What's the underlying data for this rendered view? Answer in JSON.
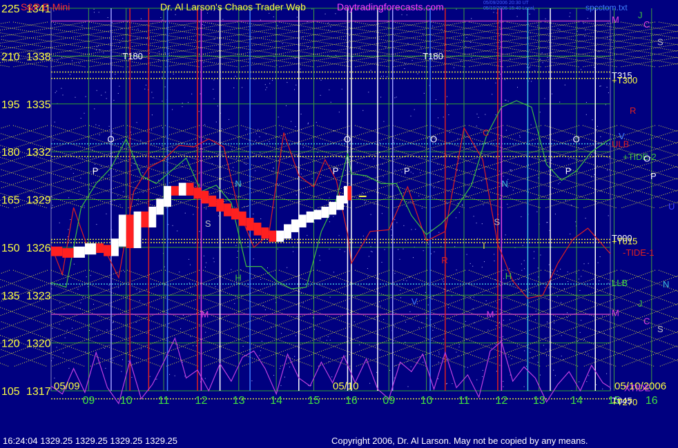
{
  "header": {
    "product": "S&P E-Mini",
    "title": "Dr. Al Larson's Chaos Trader Web",
    "website": "Daytradingforecasts.com",
    "file": "spcctom.txt",
    "stamp_line1": "05/09/2006 20:30 UT",
    "stamp_line2": "05/10/2006 15:40 Local"
  },
  "footer": {
    "status": "16:24:04  1329.25 1329.25 1329.25 1329.25",
    "copyright": "Copyright 2006, Dr. Al Larson. May not be copied by any means."
  },
  "colors": {
    "background": "#000080",
    "price_up": "#ffffff",
    "price_down": "#ff2020",
    "green_line": "#40c040",
    "red_line": "#e02020",
    "magenta_line": "#c040e0",
    "yellow_dotted": "#e0e040",
    "magenta_level": "#c040c0",
    "cyan": "#40c0e0"
  },
  "chart_data": {
    "type": "line",
    "title": "Dr. Al Larson's Chaos Trader Web",
    "y_left_labels": [
      {
        "left": "225",
        "right": "1341"
      },
      {
        "left": "210",
        "right": "1338"
      },
      {
        "left": "195",
        "right": "1335"
      },
      {
        "left": "180",
        "right": "1332"
      },
      {
        "left": "165",
        "right": "1329"
      },
      {
        "left": "150",
        "right": "1326"
      },
      {
        "left": "135",
        "right": "1323"
      },
      {
        "left": "120",
        "right": "1320"
      },
      {
        "left": "105",
        "right": "1317"
      }
    ],
    "ylim": [
      1317,
      1341
    ],
    "x_hours": [
      "09",
      "10",
      "11",
      "12",
      "13",
      "14",
      "15",
      "16",
      "09",
      "10",
      "11",
      "12",
      "13",
      "14",
      "15",
      "16"
    ],
    "date_labels": [
      "05/09",
      "05/10",
      "05/10/2006"
    ],
    "right_labels": [
      {
        "text": "M",
        "color": "#e040e0",
        "price": 1340.3
      },
      {
        "text": "C",
        "color": "#e040e0",
        "price": 1340.0
      },
      {
        "text": "J",
        "color": "#40c040",
        "price": 1340.6
      },
      {
        "text": "S",
        "color": "#c0c0c0",
        "price": 1338.9
      },
      {
        "text": "T315",
        "color": "#ffffff",
        "price": 1336.8
      },
      {
        "text": "+T300",
        "color": "#ffff40",
        "price": 1336.5
      },
      {
        "text": "R",
        "color": "#e02020",
        "price": 1334.6
      },
      {
        "text": "V",
        "color": "#4080ff",
        "price": 1333.0
      },
      {
        "text": "ULB",
        "color": "#e02020",
        "price": 1332.5
      },
      {
        "text": "+TIDE-2",
        "color": "#40c040",
        "price": 1331.7
      },
      {
        "text": "O",
        "color": "#ffffff",
        "price": 1331.6
      },
      {
        "text": "P",
        "color": "#ffffff",
        "price": 1330.5
      },
      {
        "text": "U",
        "color": "#4040ff",
        "price": 1328.6
      },
      {
        "text": "T000",
        "color": "#ffffff",
        "price": 1326.6
      },
      {
        "text": "+T015",
        "color": "#ffff40",
        "price": 1326.4
      },
      {
        "text": "-TIDE-1",
        "color": "#e02020",
        "price": 1325.7
      },
      {
        "text": "LLB",
        "color": "#40e040",
        "price": 1323.8
      },
      {
        "text": "N",
        "color": "#40c0e0",
        "price": 1323.7
      },
      {
        "text": "J",
        "color": "#40c040",
        "price": 1322.5
      },
      {
        "text": "M",
        "color": "#e040e0",
        "price": 1321.9
      },
      {
        "text": "C",
        "color": "#e040e0",
        "price": 1321.4
      },
      {
        "text": "S",
        "color": "#c0c0c0",
        "price": 1320.9
      },
      {
        "text": "XTIDE",
        "color": "#e040e0",
        "price": 1317.2
      },
      {
        "text": "T045",
        "color": "#ffffff",
        "price": 1316.4
      },
      {
        "text": "+T270",
        "color": "#ffff40",
        "price": 1316.3
      }
    ],
    "inner_labels": [
      {
        "text": "T180",
        "color": "#ffffff",
        "hour": 9.9,
        "price": 1337.8
      },
      {
        "text": "T180",
        "color": "#ffffff",
        "hour": 17.9,
        "price": 1337.8
      },
      {
        "text": "O",
        "color": "#ffffff",
        "hour": 9.5,
        "price": 1332.6
      },
      {
        "text": "O",
        "color": "#ffffff",
        "hour": 15.8,
        "price": 1332.6
      },
      {
        "text": "O",
        "color": "#ffffff",
        "hour": 18.1,
        "price": 1332.6
      },
      {
        "text": "O",
        "color": "#ffffff",
        "hour": 21.9,
        "price": 1332.6
      },
      {
        "text": "P",
        "color": "#ffffff",
        "hour": 9.1,
        "price": 1330.6
      },
      {
        "text": "P",
        "color": "#ffffff",
        "hour": 15.5,
        "price": 1330.6
      },
      {
        "text": "P",
        "color": "#ffffff",
        "hour": 17.4,
        "price": 1330.6
      },
      {
        "text": "P",
        "color": "#ffffff",
        "hour": 21.7,
        "price": 1330.6
      },
      {
        "text": "N",
        "color": "#40c0e0",
        "hour": 12.9,
        "price": 1329.8
      },
      {
        "text": "N",
        "color": "#40c0e0",
        "hour": 20.0,
        "price": 1329.8
      },
      {
        "text": "S",
        "color": "#c0c0c0",
        "hour": 12.1,
        "price": 1327.3
      },
      {
        "text": "S",
        "color": "#c0c0c0",
        "hour": 19.8,
        "price": 1327.4
      },
      {
        "text": "H",
        "color": "#40c040",
        "hour": 12.9,
        "price": 1323.9
      },
      {
        "text": "H",
        "color": "#40c040",
        "hour": 20.1,
        "price": 1324.0
      },
      {
        "text": "C",
        "color": "#e02020",
        "hour": 19.5,
        "price": 1333.0
      },
      {
        "text": "R",
        "color": "#e02020",
        "hour": 18.4,
        "price": 1325.0
      },
      {
        "text": "V",
        "color": "#4080ff",
        "hour": 17.6,
        "price": 1322.4
      },
      {
        "text": "M",
        "color": "#e040e0",
        "hour": 12.0,
        "price": 1321.6
      },
      {
        "text": "M",
        "color": "#e040e0",
        "hour": 19.6,
        "price": 1321.6
      },
      {
        "text": "I",
        "color": "#e0e040",
        "hour": 19.5,
        "price": 1325.9
      }
    ],
    "price_series": {
      "name": "S&P E-Mini",
      "x": [
        8.0,
        8.3,
        8.6,
        8.9,
        9.2,
        9.4,
        9.6,
        9.8,
        10.0,
        10.2,
        10.4,
        10.6,
        10.8,
        11.0,
        11.2,
        11.4,
        11.6,
        11.8,
        12.0,
        12.2,
        12.4,
        12.6,
        12.8,
        13.0,
        13.2,
        13.4,
        13.6,
        13.8,
        14.0,
        14.2,
        14.4,
        14.6,
        14.8,
        15.0,
        15.2,
        15.4,
        15.6,
        15.8,
        15.9,
        16.0
      ],
      "y": [
        1325.8,
        1325.7,
        1325.6,
        1325.8,
        1326.0,
        1325.9,
        1325.7,
        1326.3,
        1327.8,
        1326.2,
        1328.0,
        1327.5,
        1328.3,
        1328.8,
        1329.6,
        1329.5,
        1329.8,
        1329.5,
        1329.3,
        1329.0,
        1328.8,
        1328.5,
        1328.2,
        1328.0,
        1327.6,
        1327.3,
        1327.0,
        1326.8,
        1326.6,
        1326.8,
        1327.2,
        1327.5,
        1327.8,
        1328.0,
        1328.1,
        1328.3,
        1328.6,
        1329.0,
        1329.6,
        1329.2
      ]
    },
    "green_series": {
      "x": [
        8.0,
        8.4,
        8.8,
        9.2,
        9.6,
        10.0,
        10.4,
        10.8,
        11.2,
        11.6,
        12.0,
        12.4,
        12.8,
        13.2,
        13.6,
        14.0,
        14.4,
        14.8,
        15.2,
        15.6,
        15.9,
        16.0,
        16.4,
        16.8,
        17.2,
        17.6,
        18.0,
        18.4,
        18.8,
        19.2,
        19.6,
        20.0,
        20.4,
        20.8,
        21.2,
        21.6,
        22.0,
        22.4,
        22.9
      ],
      "y": [
        1323.8,
        1323.5,
        1328.5,
        1330.0,
        1331.0,
        1332.8,
        1330.5,
        1330.0,
        1330.8,
        1331.6,
        1329.5,
        1329.9,
        1328.8,
        1324.8,
        1324.8,
        1323.9,
        1323.4,
        1323.5,
        1327.0,
        1329.0,
        1331.9,
        1330.6,
        1330.5,
        1330.0,
        1330.0,
        1328.0,
        1326.8,
        1327.5,
        1328.5,
        1329.9,
        1333.0,
        1334.8,
        1335.2,
        1334.8,
        1331.2,
        1330.2,
        1330.8,
        1332.0,
        1332.8
      ]
    },
    "red_series": {
      "x": [
        8.0,
        8.3,
        8.6,
        9.0,
        9.4,
        9.8,
        10.2,
        10.6,
        11.0,
        11.4,
        11.8,
        12.2,
        12.6,
        13.0,
        13.4,
        13.8,
        14.2,
        14.6,
        15.0,
        15.3,
        15.6,
        15.9,
        16.0,
        16.5,
        17.0,
        17.5,
        18.0,
        18.5,
        19.0,
        19.5,
        19.9,
        20.3,
        20.7,
        21.1,
        21.5,
        21.9,
        22.3,
        22.9
      ],
      "y": [
        1326.1,
        1324.3,
        1328.5,
        1325.8,
        1326.0,
        1324.1,
        1329.5,
        1331.0,
        1331.5,
        1332.4,
        1332.3,
        1332.8,
        1332.3,
        1328.3,
        1326.0,
        1326.8,
        1333.2,
        1330.5,
        1329.8,
        1331.5,
        1330.2,
        1326.8,
        1325.0,
        1327.0,
        1327.1,
        1329.8,
        1326.4,
        1327.0,
        1333.5,
        1331.5,
        1326.2,
        1323.9,
        1322.8,
        1323.0,
        1325.0,
        1326.5,
        1327.2,
        1325.6
      ]
    },
    "xtide_series": {
      "name": "XTIDE",
      "x": [
        8.0,
        8.3,
        8.6,
        8.9,
        9.2,
        9.5,
        9.8,
        10.1,
        10.4,
        10.7,
        11.0,
        11.3,
        11.6,
        11.9,
        12.2,
        12.5,
        12.8,
        13.1,
        13.4,
        13.7,
        14.0,
        14.3,
        14.6,
        14.9,
        15.2,
        15.5,
        15.8,
        16.1,
        16.4,
        16.7,
        17.0,
        17.3,
        17.6,
        17.9,
        18.2,
        18.5,
        18.8,
        19.1,
        19.4,
        19.7,
        20.0,
        20.3,
        20.6,
        20.9,
        21.2,
        21.5,
        21.8,
        22.1,
        22.4,
        22.7,
        22.9
      ],
      "y": [
        1317.3,
        1316.8,
        1318.4,
        1316.9,
        1319.4,
        1317.2,
        1316.2,
        1318.9,
        1316.5,
        1317.4,
        1318.8,
        1320.3,
        1317.8,
        1318.3,
        1317.0,
        1318.7,
        1317.6,
        1319.1,
        1319.5,
        1318.4,
        1316.8,
        1319.3,
        1317.8,
        1317.3,
        1318.8,
        1317.5,
        1319.2,
        1317.5,
        1319.0,
        1317.1,
        1316.5,
        1318.8,
        1318.2,
        1319.3,
        1317.1,
        1319.4,
        1317.2,
        1318.0,
        1316.6,
        1319.5,
        1320.1,
        1317.6,
        1318.5,
        1317.8,
        1316.3,
        1317.4,
        1318.2,
        1317.0,
        1318.6,
        1317.5,
        1317.2
      ]
    },
    "horizontal_levels": [
      {
        "price": 1340.2,
        "color": "#c040c0",
        "dash": false
      },
      {
        "price": 1337.0,
        "color": "#e0e040",
        "dash": true
      },
      {
        "price": 1336.6,
        "color": "#e0e040",
        "dash": true
      },
      {
        "price": 1332.5,
        "color": "#40c0e0",
        "dash": true
      },
      {
        "price": 1331.7,
        "color": "#e0e040",
        "dash": true
      },
      {
        "price": 1326.5,
        "color": "#e0e040",
        "dash": true
      },
      {
        "price": 1326.3,
        "color": "#e0e040",
        "dash": true
      },
      {
        "price": 1323.7,
        "color": "#40c0e0",
        "dash": true
      },
      {
        "price": 1321.8,
        "color": "#c040c0",
        "dash": false
      },
      {
        "price": 1316.5,
        "color": "#e0e040",
        "dash": true
      }
    ],
    "vertical_markers": [
      {
        "hour": 9.6,
        "color": "#a0a0ff"
      },
      {
        "hour": 10.1,
        "color": "#e02020"
      },
      {
        "hour": 10.6,
        "color": "#e02020"
      },
      {
        "hour": 11.1,
        "color": "#4080ff"
      },
      {
        "hour": 11.9,
        "color": "#e02020"
      },
      {
        "hour": 12.0,
        "color": "#e040e0"
      },
      {
        "hour": 12.5,
        "color": "#ffffff"
      },
      {
        "hour": 13.3,
        "color": "#4080ff"
      },
      {
        "hour": 14.6,
        "color": "#ffffff"
      },
      {
        "hour": 15.9,
        "color": "#ffffff"
      },
      {
        "hour": 16.0,
        "color": "#ffffff"
      },
      {
        "hour": 16.7,
        "color": "#ffffff"
      },
      {
        "hour": 17.1,
        "color": "#a0a0ff"
      },
      {
        "hour": 18.1,
        "color": "#4080ff"
      },
      {
        "hour": 18.5,
        "color": "#e02020"
      },
      {
        "hour": 19.9,
        "color": "#e02020"
      },
      {
        "hour": 20.0,
        "color": "#e040e0"
      },
      {
        "hour": 20.7,
        "color": "#40c0e0"
      },
      {
        "hour": 21.3,
        "color": "#ffffff"
      },
      {
        "hour": 22.5,
        "color": "#ffffff"
      }
    ]
  }
}
